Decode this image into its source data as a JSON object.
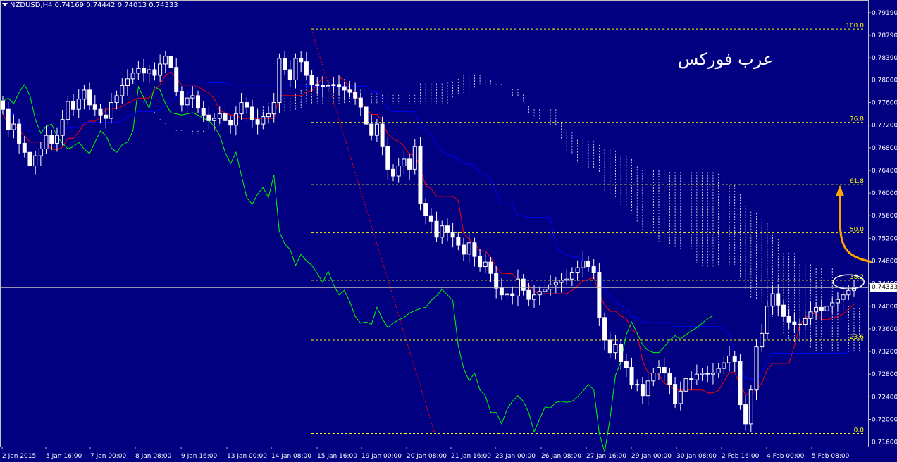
{
  "header": {
    "symbol": "NZDUSD,H4",
    "ohlc": "0.74169 0.74442 0.74013 0.74333"
  },
  "watermark": "عرب فوركس",
  "current_price": "0.74333",
  "colors": {
    "background": "#000080",
    "candle": "#ffffff",
    "tenkan": "#ff0000",
    "kijun": "#0000ff",
    "chikou": "#00ff00",
    "fib": "#ffff00",
    "arrow": "#ffa500"
  },
  "chart_data": {
    "type": "candlestick",
    "y_ticks": [
      "0.79190",
      "0.78790",
      "0.78390",
      "0.78000",
      "0.77600",
      "0.77200",
      "0.76800",
      "0.76400",
      "0.76000",
      "0.75600",
      "0.75200",
      "0.74800",
      "0.74400",
      "0.74000",
      "0.73600",
      "0.73200",
      "0.72800",
      "0.72400",
      "0.72000",
      "0.71600"
    ],
    "ylim": [
      0.7152,
      0.7935
    ],
    "x_ticks": [
      "2 Jan 2015",
      "5 Jan 16:00",
      "7 Jan 00:00",
      "8 Jan 08:00",
      "9 Jan 16:00",
      "13 Jan 00:00",
      "14 Jan 08:00",
      "15 Jan 16:00",
      "19 Jan 00:00",
      "20 Jan 08:00",
      "21 Jan 16:00",
      "23 Jan 00:00",
      "26 Jan 08:00",
      "27 Jan 16:00",
      "29 Jan 00:00",
      "30 Jan 08:00",
      "2 Feb 16:00",
      "4 Feb 00:00",
      "5 Feb 08:00"
    ],
    "fib_levels": [
      {
        "label": "100.0",
        "value": 0.789
      },
      {
        "label": "76.8",
        "value": 0.7725
      },
      {
        "label": "61.8",
        "value": 0.7615
      },
      {
        "label": "50.0",
        "value": 0.753
      },
      {
        "label": "38.2",
        "value": 0.7446
      },
      {
        "label": "23.6",
        "value": 0.734
      },
      {
        "label": "0.0",
        "value": 0.7175
      }
    ],
    "closes": [
      0.7748,
      0.7712,
      0.7722,
      0.7688,
      0.7672,
      0.7648,
      0.7666,
      0.7678,
      0.7702,
      0.7688,
      0.7702,
      0.773,
      0.7762,
      0.7748,
      0.7766,
      0.7782,
      0.7756,
      0.7748,
      0.7738,
      0.7732,
      0.776,
      0.7772,
      0.779,
      0.7802,
      0.7812,
      0.782,
      0.7812,
      0.7818,
      0.7808,
      0.7828,
      0.7842,
      0.7822,
      0.778,
      0.7756,
      0.7768,
      0.7772,
      0.775,
      0.7738,
      0.7728,
      0.7732,
      0.774,
      0.7728,
      0.772,
      0.774,
      0.776,
      0.7752,
      0.773,
      0.7722,
      0.7735,
      0.774,
      0.776,
      0.7838,
      0.7818,
      0.78,
      0.7838,
      0.7832,
      0.7808,
      0.7792,
      0.779,
      0.7788,
      0.779,
      0.7792,
      0.7788,
      0.7782,
      0.7778,
      0.7768,
      0.7752,
      0.7722,
      0.7702,
      0.7722,
      0.7682,
      0.7642,
      0.763,
      0.7648,
      0.766,
      0.7642,
      0.7682,
      0.7582,
      0.756,
      0.755,
      0.7522,
      0.7542,
      0.753,
      0.7522,
      0.7508,
      0.7492,
      0.7512,
      0.7488,
      0.747,
      0.7478,
      0.7458,
      0.7432,
      0.742,
      0.7422,
      0.7418,
      0.7448,
      0.7428,
      0.7412,
      0.742,
      0.7426,
      0.743,
      0.7438,
      0.7442,
      0.7446,
      0.7448,
      0.746,
      0.7468,
      0.748,
      0.747,
      0.746,
      0.738,
      0.734,
      0.7318,
      0.7332,
      0.7302,
      0.7292,
      0.7262,
      0.7262,
      0.7242,
      0.7268,
      0.7282,
      0.7292,
      0.7282,
      0.7262,
      0.7228,
      0.725,
      0.7272,
      0.727,
      0.728,
      0.7282,
      0.728,
      0.7282,
      0.729,
      0.73,
      0.7312,
      0.7302,
      0.7226,
      0.7192,
      0.7252,
      0.7328,
      0.7352,
      0.74,
      0.7422,
      0.7402,
      0.7382,
      0.7372,
      0.7368,
      0.7368,
      0.7378,
      0.739,
      0.7398,
      0.7392,
      0.74,
      0.7406,
      0.7412,
      0.742,
      0.7428,
      0.7433
    ]
  }
}
